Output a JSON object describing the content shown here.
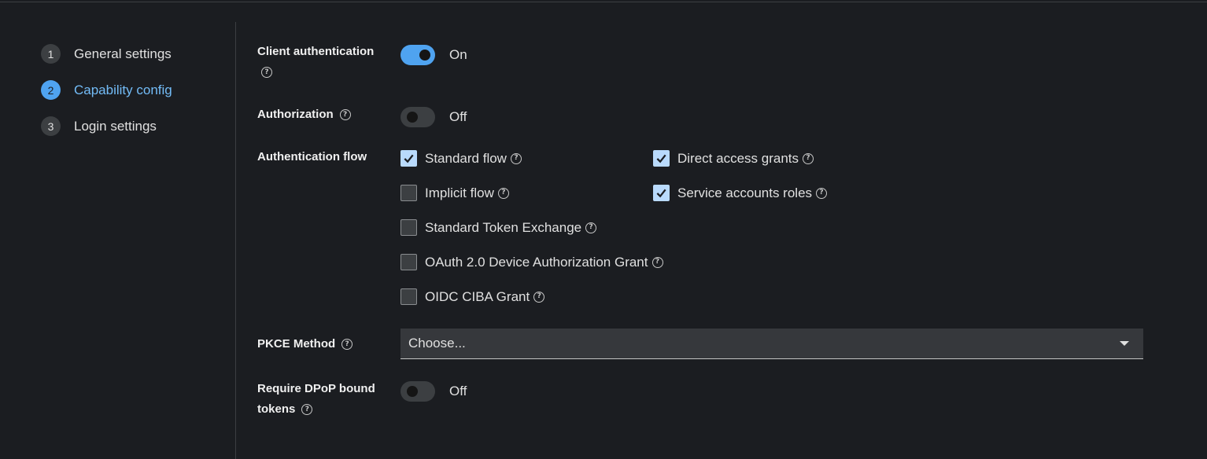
{
  "wizard": {
    "steps": [
      {
        "number": "1",
        "label": "General settings"
      },
      {
        "number": "2",
        "label": "Capability config"
      },
      {
        "number": "3",
        "label": "Login settings"
      }
    ],
    "current_step": 2
  },
  "form": {
    "client_authentication": {
      "label": "Client authentication",
      "state": "On"
    },
    "authorization": {
      "label": "Authorization",
      "state": "Off"
    },
    "authentication_flow": {
      "label": "Authentication flow",
      "options": [
        {
          "label": "Standard flow",
          "checked": true
        },
        {
          "label": "Direct access grants",
          "checked": true
        },
        {
          "label": "Implicit flow",
          "checked": false
        },
        {
          "label": "Service accounts roles",
          "checked": true
        },
        {
          "label": "Standard Token Exchange",
          "checked": false
        },
        {
          "label": "OAuth 2.0 Device Authorization Grant",
          "checked": false
        },
        {
          "label": "OIDC CIBA Grant",
          "checked": false
        }
      ]
    },
    "pkce_method": {
      "label": "PKCE Method",
      "value": "Choose..."
    },
    "require_dpop": {
      "label_line1": "Require DPoP bound",
      "label_line2": "tokens",
      "state": "Off"
    }
  },
  "icons": {
    "help": "help-circle-icon",
    "check": "checkmark-icon",
    "caret": "caret-down-icon"
  },
  "colors": {
    "accent": "#4fa3f0",
    "active_text": "#73bcf7",
    "background": "#1b1d21",
    "checked_box": "#b9dafc"
  }
}
